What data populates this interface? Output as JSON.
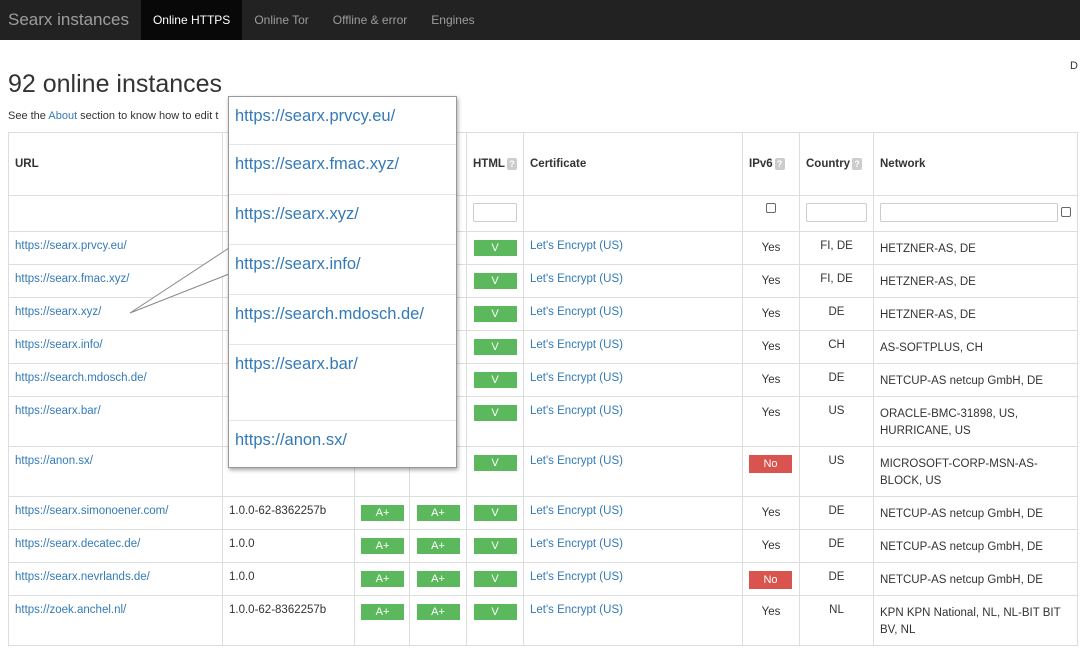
{
  "nav": {
    "brand": "Searx instances",
    "items": [
      "Online HTTPS",
      "Online Tor",
      "Offline & error",
      "Engines"
    ],
    "edge_char": "D"
  },
  "page": {
    "title": "92 online instances",
    "subtitle_prefix": "See the ",
    "about_link": "About",
    "subtitle_suffix": " section to know how to edit t"
  },
  "table": {
    "headers": {
      "url": "URL",
      "html": "HTML",
      "certificate": "Certificate",
      "ipv6": "IPv6",
      "country": "Country",
      "network": "Network"
    },
    "help_glyph": "?",
    "rows": [
      {
        "url": "https://searx.prvcy.eu/",
        "version": "",
        "g1": "",
        "g2": "",
        "html": "V",
        "cert": "Let's Encrypt (US)",
        "ipv6": "Yes",
        "ipv6_bad": false,
        "country": "FI, DE",
        "network": "HETZNER-AS, DE"
      },
      {
        "url": "https://searx.fmac.xyz/",
        "version": "",
        "g1": "",
        "g2": "",
        "html": "V",
        "cert": "Let's Encrypt (US)",
        "ipv6": "Yes",
        "ipv6_bad": false,
        "country": "FI, DE",
        "network": "HETZNER-AS, DE"
      },
      {
        "url": "https://searx.xyz/",
        "version": "",
        "g1": "",
        "g2": "",
        "html": "V",
        "cert": "Let's Encrypt (US)",
        "ipv6": "Yes",
        "ipv6_bad": false,
        "country": "DE",
        "network": "HETZNER-AS, DE"
      },
      {
        "url": "https://searx.info/",
        "version": "",
        "g1": "",
        "g2": "",
        "html": "V",
        "cert": "Let's Encrypt (US)",
        "ipv6": "Yes",
        "ipv6_bad": false,
        "country": "CH",
        "network": "AS-SOFTPLUS, CH"
      },
      {
        "url": "https://search.mdosch.de/",
        "version": "",
        "g1": "",
        "g2": "",
        "html": "V",
        "cert": "Let's Encrypt (US)",
        "ipv6": "Yes",
        "ipv6_bad": false,
        "country": "DE",
        "network": "NETCUP-AS netcup GmbH, DE"
      },
      {
        "url": "https://searx.bar/",
        "version": "",
        "g1": "",
        "g2": "",
        "html": "V",
        "cert": "Let's Encrypt (US)",
        "ipv6": "Yes",
        "ipv6_bad": false,
        "country": "US",
        "network": "ORACLE-BMC-31898, US, HURRICANE, US"
      },
      {
        "url": "https://anon.sx/",
        "version": "",
        "g1": "",
        "g2": "",
        "html": "V",
        "cert": "Let's Encrypt (US)",
        "ipv6": "No",
        "ipv6_bad": true,
        "country": "US",
        "network": "MICROSOFT-CORP-MSN-AS-BLOCK, US"
      },
      {
        "url": "https://searx.simonoener.com/",
        "version": "1.0.0-62-8362257b",
        "g1": "A+",
        "g2": "A+",
        "html": "V",
        "cert": "Let's Encrypt (US)",
        "ipv6": "Yes",
        "ipv6_bad": false,
        "country": "DE",
        "network": "NETCUP-AS netcup GmbH, DE"
      },
      {
        "url": "https://searx.decatec.de/",
        "version": "1.0.0",
        "g1": "A+",
        "g2": "A+",
        "html": "V",
        "cert": "Let's Encrypt (US)",
        "ipv6": "Yes",
        "ipv6_bad": false,
        "country": "DE",
        "network": "NETCUP-AS netcup GmbH, DE"
      },
      {
        "url": "https://searx.nevrlands.de/",
        "version": "1.0.0",
        "g1": "A+",
        "g2": "A+",
        "html": "V",
        "cert": "Let's Encrypt (US)",
        "ipv6": "No",
        "ipv6_bad": true,
        "country": "DE",
        "network": "NETCUP-AS netcup GmbH, DE"
      },
      {
        "url": "https://zoek.anchel.nl/",
        "version": "1.0.0-62-8362257b",
        "g1": "A+",
        "g2": "A+",
        "html": "V",
        "cert": "Let's Encrypt (US)",
        "ipv6": "Yes",
        "ipv6_bad": false,
        "country": "NL",
        "network": "KPN KPN National, NL, NL-BIT BIT BV, NL"
      }
    ]
  },
  "popup": {
    "items": [
      "https://searx.prvcy.eu/",
      "https://searx.fmac.xyz/",
      "https://searx.xyz/",
      "https://searx.info/",
      "https://search.mdosch.de/",
      "https://searx.bar/",
      "https://anon.sx/"
    ]
  },
  "colors": {
    "navbar": "#222222",
    "link": "#337ab7",
    "grade_green": "#5cb85c",
    "status_red": "#d9534f"
  }
}
